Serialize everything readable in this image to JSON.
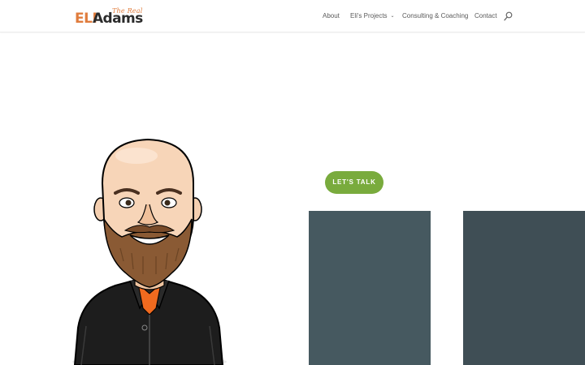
{
  "header": {
    "logo": {
      "first": "ELI",
      "last": "Adams",
      "tagline": "The Real",
      "accent_color": "#e07c3c",
      "text_color": "#2b2b2b"
    },
    "nav": {
      "items": [
        {
          "label": "About"
        },
        {
          "label": "Eli's Projects",
          "has_dropdown": true
        },
        {
          "label": "Consulting & Coaching"
        },
        {
          "label": "Contact"
        }
      ],
      "search_icon": "search-icon"
    }
  },
  "hero": {
    "cta_label": "LET'S TALK",
    "cta_color": "#79ab3d",
    "avatar": "caricature-avatar"
  },
  "panels": [
    {
      "color": "#465960"
    },
    {
      "color": "#3f4e55"
    }
  ]
}
